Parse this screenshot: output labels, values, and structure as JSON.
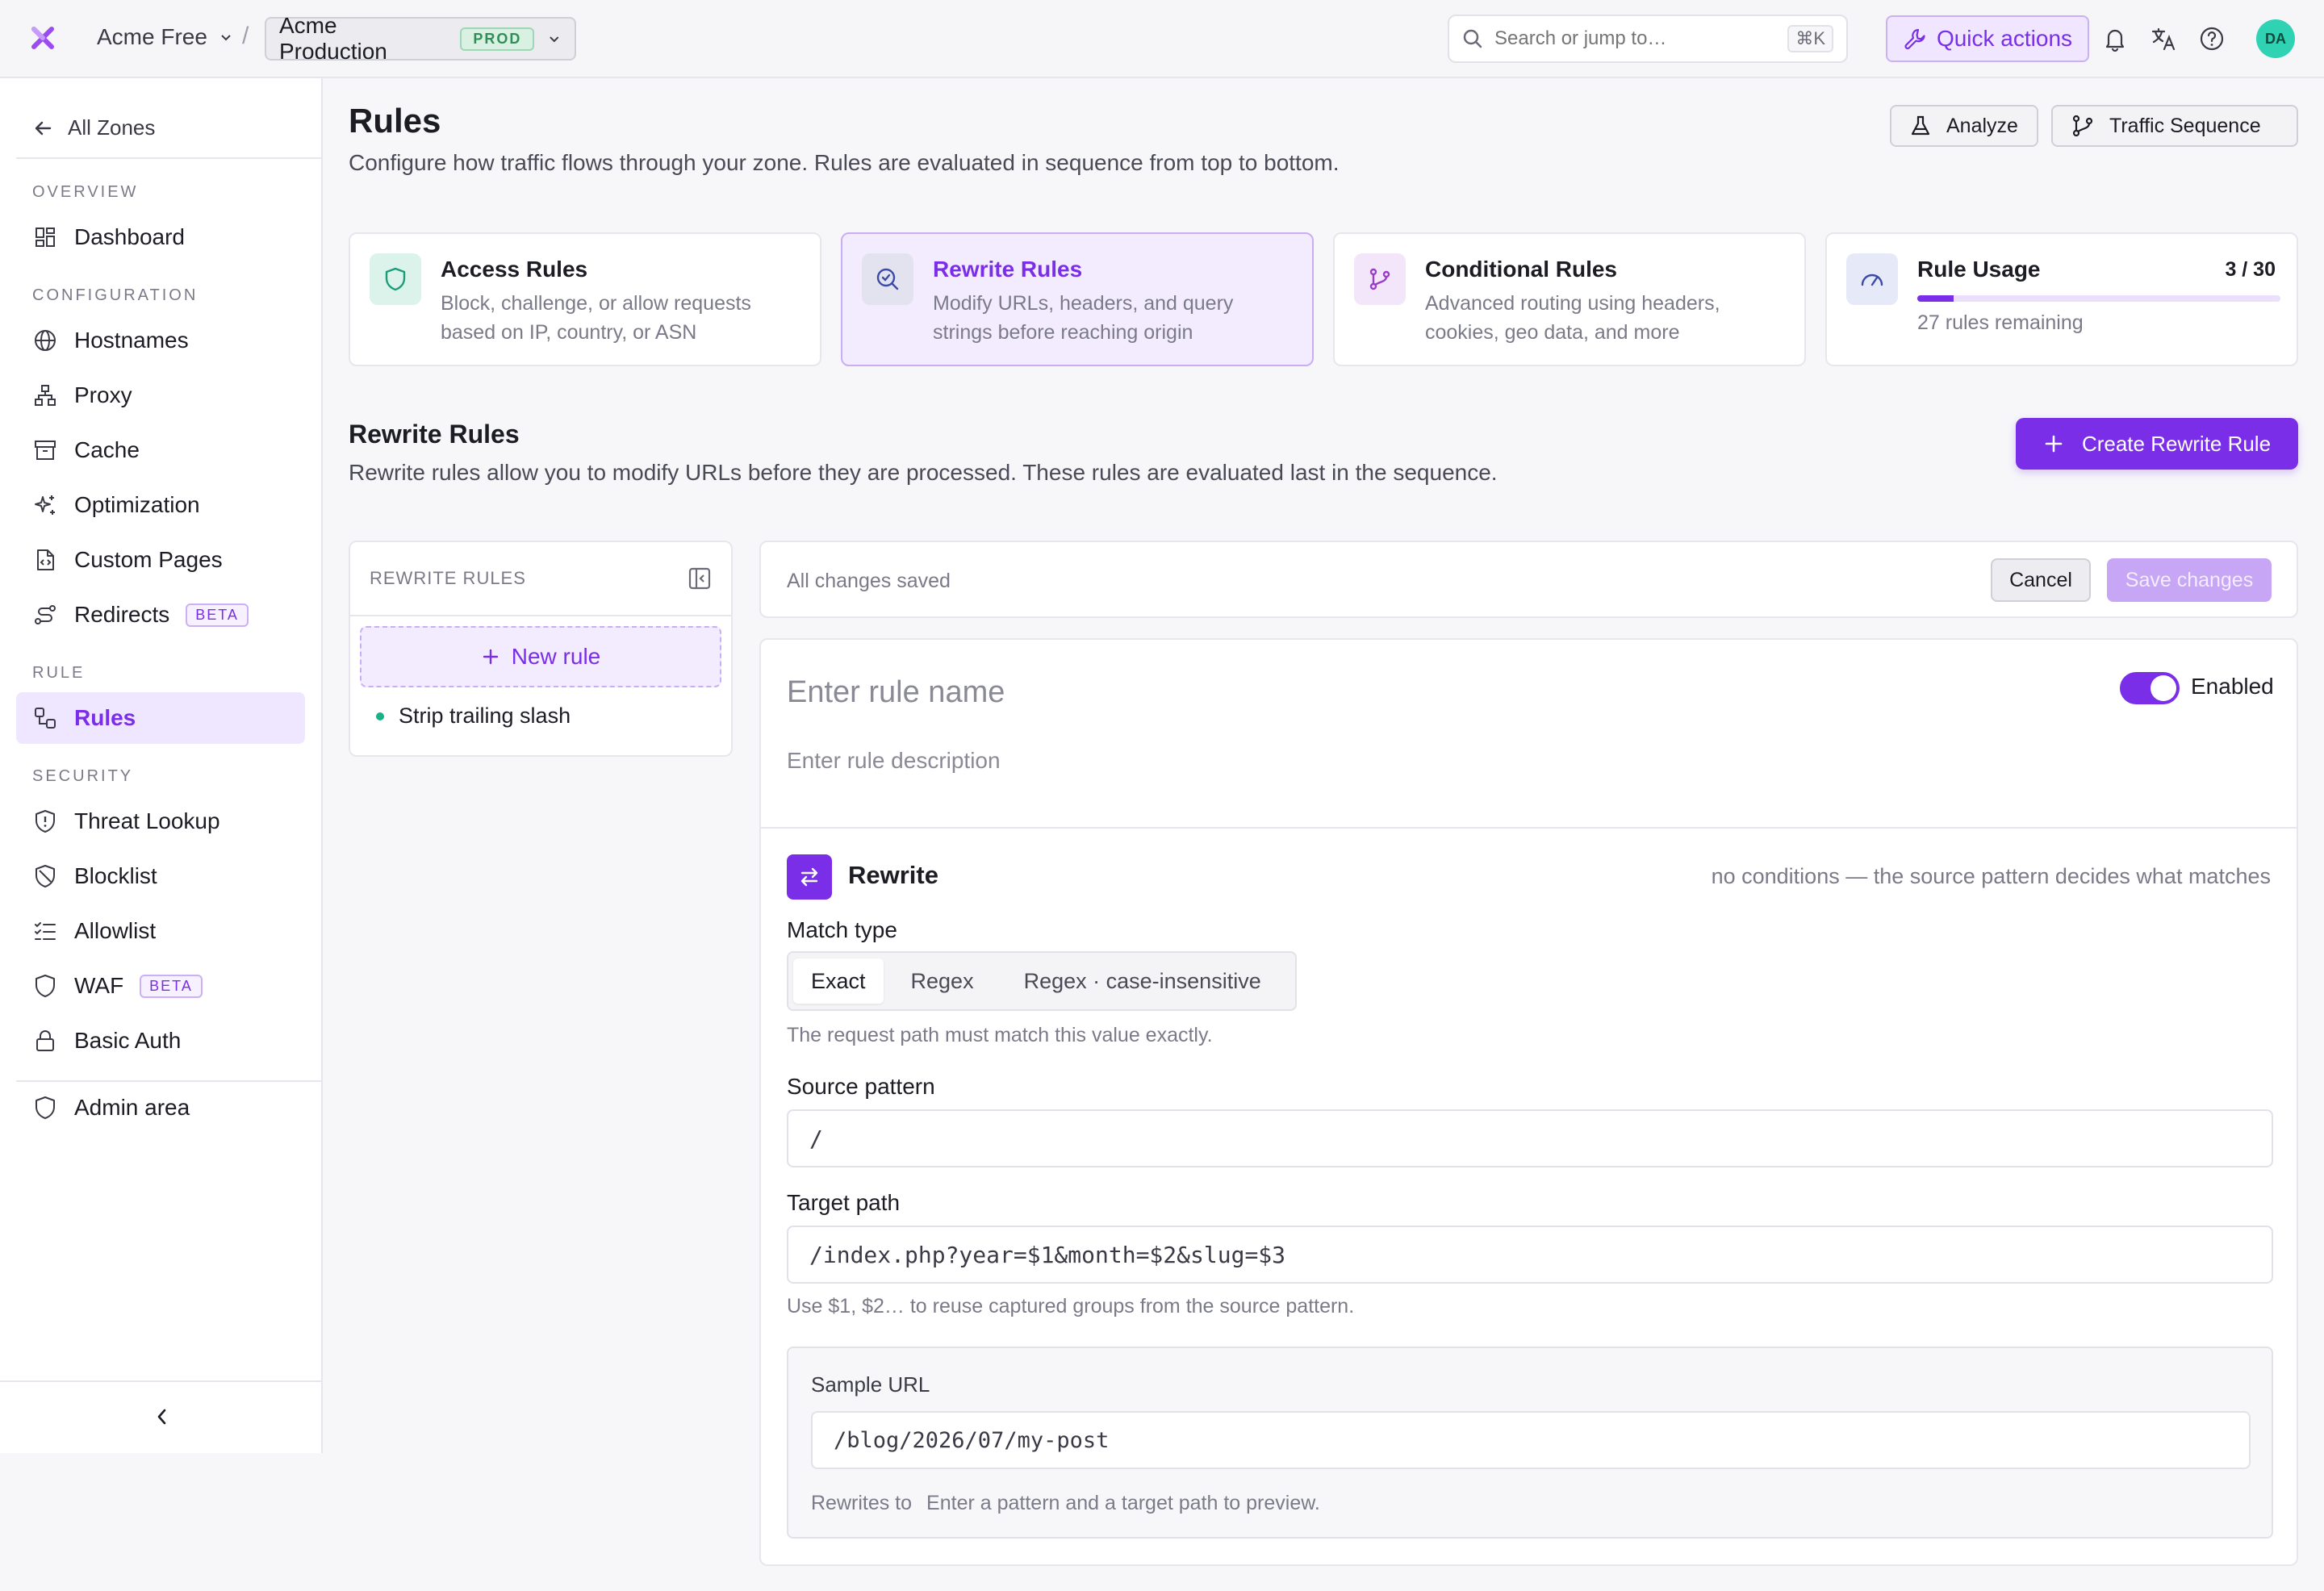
{
  "topbar": {
    "org_name": "Acme Free",
    "separator": "/",
    "zone_name": "Acme Production",
    "zone_badge": "PROD",
    "search_placeholder": "Search or jump to…",
    "search_shortcut": "⌘K",
    "quick_actions_label": "Quick actions",
    "avatar_initials": "DA"
  },
  "sidebar": {
    "back_label": "All Zones",
    "sections": {
      "overview": "OVERVIEW",
      "configuration": "CONFIGURATION",
      "rule": "RULE",
      "security": "SECURITY"
    },
    "items": {
      "dashboard": "Dashboard",
      "hostnames": "Hostnames",
      "proxy": "Proxy",
      "cache": "Cache",
      "optimization": "Optimization",
      "custom_pages": "Custom Pages",
      "redirects": "Redirects",
      "rules": "Rules",
      "threat_lookup": "Threat Lookup",
      "blocklist": "Blocklist",
      "allowlist": "Allowlist",
      "waf": "WAF",
      "basic_auth": "Basic Auth",
      "admin_area": "Admin area"
    },
    "beta_label": "BETA"
  },
  "header": {
    "title": "Rules",
    "subtitle": "Configure how traffic flows through your zone. Rules are evaluated in sequence from top to bottom.",
    "analyze_label": "Analyze",
    "traffic_sequence_label": "Traffic Sequence"
  },
  "cards": {
    "access": {
      "title": "Access Rules",
      "desc": "Block, challenge, or allow requests based on IP, country, or ASN"
    },
    "rewrite": {
      "title": "Rewrite Rules",
      "desc": "Modify URLs, headers, and query strings before reaching origin"
    },
    "conditional": {
      "title": "Conditional Rules",
      "desc": "Advanced routing using headers, cookies, geo data, and more"
    },
    "usage": {
      "title": "Rule Usage",
      "count": "3 / 30",
      "used": 3,
      "total": 30,
      "remaining": "27 rules remaining"
    }
  },
  "section": {
    "title": "Rewrite Rules",
    "subtitle": "Rewrite rules allow you to modify URLs before they are processed. These rules are evaluated last in the sequence.",
    "create_label": "Create Rewrite Rule"
  },
  "rule_list": {
    "header": "REWRITE RULES",
    "new_rule_label": "New rule",
    "rules": [
      "Strip trailing slash"
    ]
  },
  "save_bar": {
    "status": "All changes saved",
    "cancel_label": "Cancel",
    "save_label": "Save changes"
  },
  "editor": {
    "name_placeholder": "Enter rule name",
    "desc_placeholder": "Enter rule description",
    "enabled_label": "Enabled",
    "enabled": true,
    "rewrite_title": "Rewrite",
    "rewrite_note": "no conditions — the source pattern decides what matches",
    "match_type_label": "Match type",
    "match_options": [
      "Exact",
      "Regex",
      "Regex · case-insensitive"
    ],
    "match_selected": "Exact",
    "match_help": "The request path must match this value exactly.",
    "source_label": "Source pattern",
    "source_value": "/",
    "target_label": "Target path",
    "target_value": "/index.php?year=$1&month=$2&slug=$3",
    "target_help": "Use $1, $2… to reuse captured groups from the source pattern.",
    "sample_label": "Sample URL",
    "sample_value": "/blog/2026/07/my-post",
    "rewrites_to_label": "Rewrites to",
    "rewrites_to_value": "Enter a pattern and a target path to preview."
  },
  "colors": {
    "accent": "#7a2ee8",
    "accent_soft": "#f3ecff",
    "success": "#1ab08a",
    "text": "#1c1c24",
    "muted": "#7a7a88"
  }
}
